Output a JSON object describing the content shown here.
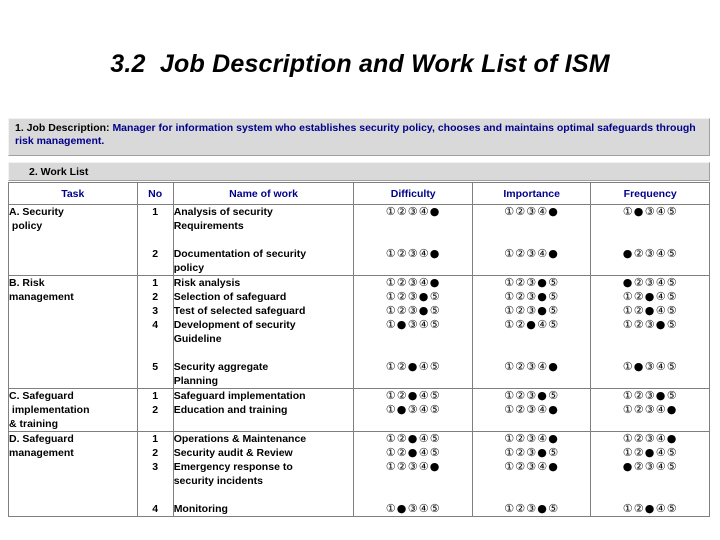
{
  "title": "3.2  Job Description and Work List of ISM",
  "job_description": {
    "label": "1. Job Description:",
    "text": "Manager for information system who establishes security policy, chooses and maintains optimal safeguards through risk management."
  },
  "work_list": {
    "label": "2. Work List",
    "columns": [
      "Task",
      "No",
      "Name of work",
      "Difficulty",
      "Importance",
      "Frequency"
    ],
    "header_colors": {
      "plain": "#000000",
      "rating": "#00008b"
    },
    "scale": [
      "①",
      "②",
      "③",
      "④",
      "⑤"
    ],
    "filled_marker": "●",
    "rows": [
      {
        "task": "A. Security\n policy",
        "items": [
          {
            "no": "1",
            "name": "Analysis of security\nRequirements",
            "difficulty": 5,
            "importance": 5,
            "frequency": 2
          },
          {
            "no": "2",
            "name": "Documentation of security\npolicy",
            "difficulty": 5,
            "importance": 5,
            "frequency": 1
          }
        ]
      },
      {
        "task": "B. Risk\nmanagement",
        "items": [
          {
            "no": "1",
            "name": "Risk analysis",
            "difficulty": 5,
            "importance": 4,
            "frequency": 1
          },
          {
            "no": "2",
            "name": "Selection of safeguard",
            "difficulty": 4,
            "importance": 4,
            "frequency": 3
          },
          {
            "no": "3",
            "name": "Test of selected safeguard",
            "difficulty": 4,
            "importance": 4,
            "frequency": 3
          },
          {
            "no": "4",
            "name": "Development of security\nGuideline",
            "difficulty": 2,
            "importance": 3,
            "frequency": 4
          },
          {
            "no": "5",
            "name": "Security aggregate\nPlanning",
            "difficulty": 3,
            "importance": 5,
            "frequency": 2
          }
        ]
      },
      {
        "task": "C. Safeguard\n implementation\n& training",
        "items": [
          {
            "no": "1",
            "name": "Safeguard implementation",
            "difficulty": 3,
            "importance": 4,
            "frequency": 4
          },
          {
            "no": "2",
            "name": "Education and training",
            "difficulty": 2,
            "importance": 5,
            "frequency": 5
          }
        ]
      },
      {
        "task": "D. Safeguard\nmanagement",
        "items": [
          {
            "no": "1",
            "name": "Operations & Maintenance",
            "difficulty": 3,
            "importance": 5,
            "frequency": 5
          },
          {
            "no": "2",
            "name": "Security audit & Review",
            "difficulty": 3,
            "importance": 4,
            "frequency": 3
          },
          {
            "no": "3",
            "name": "Emergency response to\nsecurity incidents",
            "difficulty": 5,
            "importance": 5,
            "frequency": 1
          },
          {
            "no": "4",
            "name": "Monitoring",
            "difficulty": 2,
            "importance": 4,
            "frequency": 3
          }
        ]
      }
    ]
  }
}
